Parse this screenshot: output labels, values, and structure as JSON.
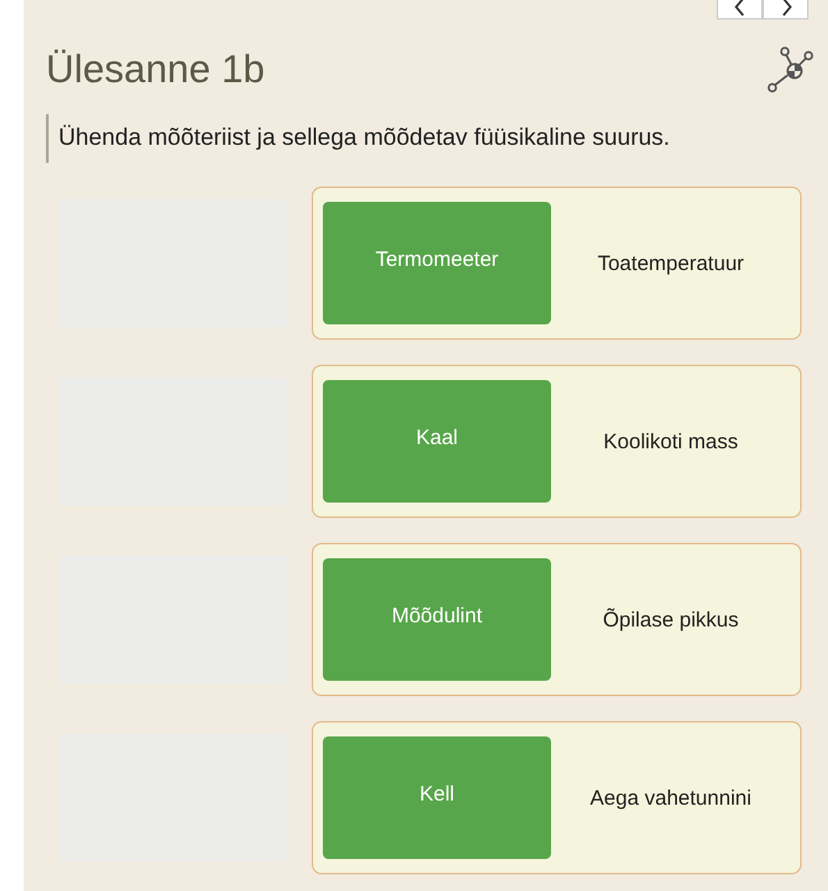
{
  "title": "Ülesanne 1b",
  "instruction": "Ühenda mõõteriist ja sellega mõõdetav füüsikaline suurus.",
  "pairs": [
    {
      "tool": "Termomeeter",
      "quantity": "Toatemperatuur"
    },
    {
      "tool": "Kaal",
      "quantity": "Koolikoti mass"
    },
    {
      "tool": "Mõõdulint",
      "quantity": "Õpilase pikkus"
    },
    {
      "tool": "Kell",
      "quantity": "Aega vahetunnini"
    }
  ]
}
